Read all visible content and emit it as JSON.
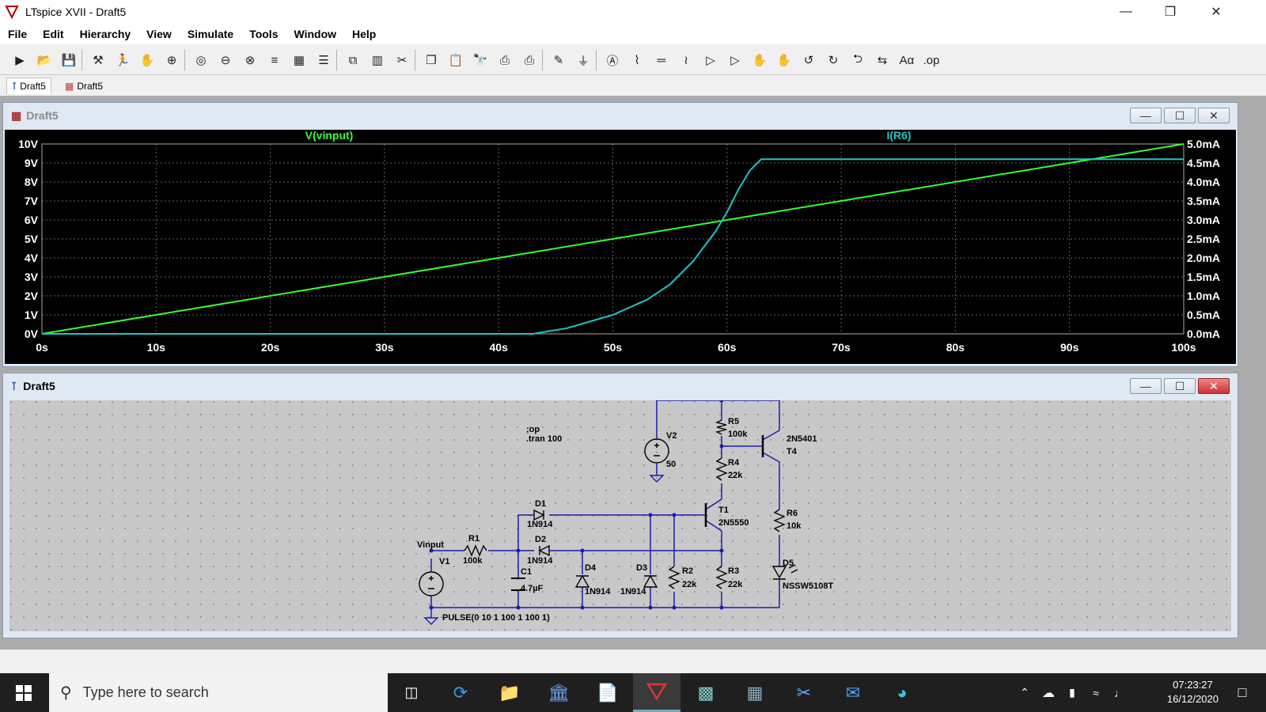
{
  "window": {
    "title": "LTspice XVII - Draft5"
  },
  "menu": [
    "File",
    "Edit",
    "Hierarchy",
    "View",
    "Simulate",
    "Tools",
    "Window",
    "Help"
  ],
  "toolbar_icons": [
    "new-schematic-icon",
    "open-icon",
    "save-icon",
    "control-panel-icon",
    "run-icon",
    "halt-icon",
    "zoom-in-icon",
    "zoom-fit-icon",
    "zoom-out-icon",
    "zoom-cancel-icon",
    "autorange-icon",
    "grid-icon",
    "tile-horizontal-icon",
    "cascade-icon",
    "tile-vertical-icon",
    "cut-icon",
    "copy-icon",
    "paste-icon",
    "find-icon",
    "print-setup-icon",
    "print-icon",
    "wire-icon",
    "ground-icon",
    "label-icon",
    "resistor-icon",
    "capacitor-icon",
    "inductor-icon",
    "diode-icon",
    "component-icon",
    "move-icon",
    "drag-icon",
    "undo-icon",
    "redo-icon",
    "rotate-icon",
    "mirror-icon",
    "text-icon",
    "spice-directive-icon"
  ],
  "tabs": [
    {
      "label": "Draft5"
    },
    {
      "label": "Draft5"
    }
  ],
  "waveform": {
    "title": "Draft5",
    "chart_data": {
      "type": "line",
      "series": [
        {
          "name": "V(vinput)",
          "color": "#33ff33",
          "axis": "left",
          "x": [
            0,
            100
          ],
          "y": [
            0,
            10
          ]
        },
        {
          "name": "I(R6)",
          "color": "#22c4c4",
          "axis": "right",
          "x": [
            0,
            43,
            46,
            50,
            53,
            55,
            57,
            58,
            59,
            60,
            61,
            62,
            63,
            100
          ],
          "y": [
            0,
            0,
            0.15,
            0.5,
            0.9,
            1.3,
            1.9,
            2.3,
            2.7,
            3.2,
            3.8,
            4.3,
            4.6,
            4.6
          ]
        }
      ],
      "xlabels": [
        "0s",
        "10s",
        "20s",
        "30s",
        "40s",
        "50s",
        "60s",
        "70s",
        "80s",
        "90s",
        "100s"
      ],
      "ylabels_left": [
        "10V",
        "9V",
        "8V",
        "7V",
        "6V",
        "5V",
        "4V",
        "3V",
        "2V",
        "1V",
        "0V"
      ],
      "ylabels_right": [
        "5.0mA",
        "4.5mA",
        "4.0mA",
        "3.5mA",
        "3.0mA",
        "2.5mA",
        "2.0mA",
        "1.5mA",
        "1.0mA",
        "0.5mA",
        "0.0mA"
      ],
      "xlim": [
        0,
        100
      ],
      "ylim_left": [
        0,
        10
      ],
      "ylim_right": [
        0,
        5
      ],
      "grid": true
    }
  },
  "schematic": {
    "title": "Draft5",
    "directives": [
      ";op",
      ".tran 100"
    ],
    "pulse": "PULSE(0 10 1 100 1 100 1)",
    "labels": {
      "vinput": "Vinput",
      "v1": "V1",
      "v2": "V2",
      "v2_val": "50",
      "r1": "R1",
      "r1_val": "100k",
      "r2": "R2",
      "r2_val": "22k",
      "r3": "R3",
      "r3_val": "22k",
      "r4": "R4",
      "r4_val": "22k",
      "r5": "R5",
      "r5_val": "100k",
      "r6": "R6",
      "r6_val": "10k",
      "c1": "C1",
      "c1_val": "4.7µF",
      "d1": "D1",
      "d1_val": "1N914",
      "d2": "D2",
      "d2_val": "1N914",
      "d3": "D3",
      "d3_val": "1N914",
      "d4": "D4",
      "d4_val": "1N914",
      "d5": "D5",
      "d5_val": "NSSW5108T",
      "t1": "T1",
      "t1_val": "2N5550",
      "t4": "T4",
      "t4_val": "2N5401"
    }
  },
  "taskbar": {
    "search_placeholder": "Type here to search",
    "time": "07:23:27",
    "date": "16/12/2020"
  }
}
